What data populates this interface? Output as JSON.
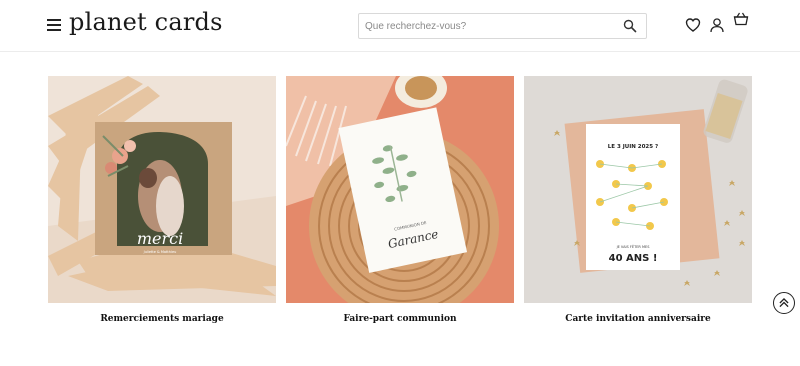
{
  "brand": {
    "name": "planet cards"
  },
  "search": {
    "placeholder": "Que recherchez-vous?"
  },
  "icons": {
    "menu": "menu-icon",
    "search": "search-icon",
    "wishlist": "heart-icon",
    "account": "user-icon",
    "cart": "basket-icon",
    "scroll_top": "double-chevron-up-icon"
  },
  "products": [
    {
      "title": "Remerciements mariage",
      "card_script": "merci",
      "card_subline": "Juliette & Matthieu"
    },
    {
      "title": "Faire-part communion",
      "card_heading": "COMMUNION DE",
      "card_name": "Garance"
    },
    {
      "title": "Carte invitation anniversaire",
      "card_question": "LE 3 JUIN 2025 ?",
      "card_banner_top": "JE VAIS FÊTER MES",
      "card_banner": "40 ANS !"
    }
  ]
}
